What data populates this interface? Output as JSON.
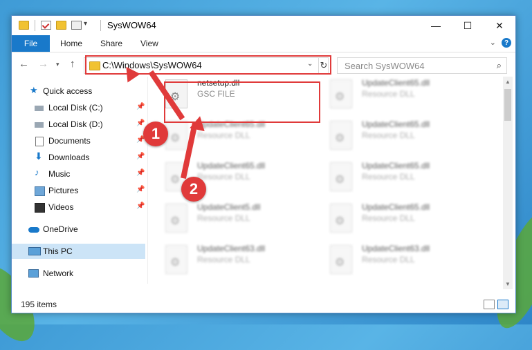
{
  "window": {
    "title": "SysWOW64"
  },
  "ribbon": {
    "tabs": [
      "File",
      "Home",
      "Share",
      "View"
    ],
    "help_icon": "help-icon"
  },
  "address": {
    "path": "C:\\Windows\\SysWOW64"
  },
  "search": {
    "placeholder": "Search SysWOW64"
  },
  "sidebar": {
    "items": [
      {
        "label": "Quick access",
        "icon": "star-icon"
      },
      {
        "label": "Local Disk (C:)",
        "icon": "drive-icon",
        "pinned": true
      },
      {
        "label": "Local Disk (D:)",
        "icon": "drive-icon",
        "pinned": true
      },
      {
        "label": "Documents",
        "icon": "documents-icon",
        "pinned": true
      },
      {
        "label": "Downloads",
        "icon": "downloads-icon",
        "pinned": true
      },
      {
        "label": "Music",
        "icon": "music-icon",
        "pinned": true
      },
      {
        "label": "Pictures",
        "icon": "pictures-icon",
        "pinned": true
      },
      {
        "label": "Videos",
        "icon": "videos-icon",
        "pinned": true
      },
      {
        "label": "OneDrive",
        "icon": "onedrive-icon"
      },
      {
        "label": "This PC",
        "icon": "pc-icon",
        "selected": true
      },
      {
        "label": "Network",
        "icon": "network-icon"
      }
    ]
  },
  "files": [
    {
      "name": "netsetup.dll",
      "type": "GSC FILE"
    },
    {
      "name": "UpdateClient65.dll",
      "type": "Resource DLL"
    },
    {
      "name": "UpdateClient65.dll",
      "type": "Resource DLL"
    },
    {
      "name": "UpdateClient65.dll",
      "type": "Resource DLL"
    },
    {
      "name": "UpdateClient65.dll",
      "type": "Resource DLL"
    },
    {
      "name": "UpdateClient65.dll",
      "type": "Resource DLL"
    },
    {
      "name": "UpdateClient5.dll",
      "type": "Resource DLL"
    },
    {
      "name": "UpdateClient65.dll",
      "type": "Resource DLL"
    },
    {
      "name": "UpdateClient63.dll",
      "type": "Resource DLL"
    },
    {
      "name": "UpdateClient63.dll",
      "type": "Resource DLL"
    }
  ],
  "status": {
    "item_count": "195 items"
  },
  "annotations": {
    "step1": "1",
    "step2": "2"
  },
  "colors": {
    "accent": "#1979ca",
    "highlight": "#e03a3a",
    "selected": "#cce4f7"
  }
}
